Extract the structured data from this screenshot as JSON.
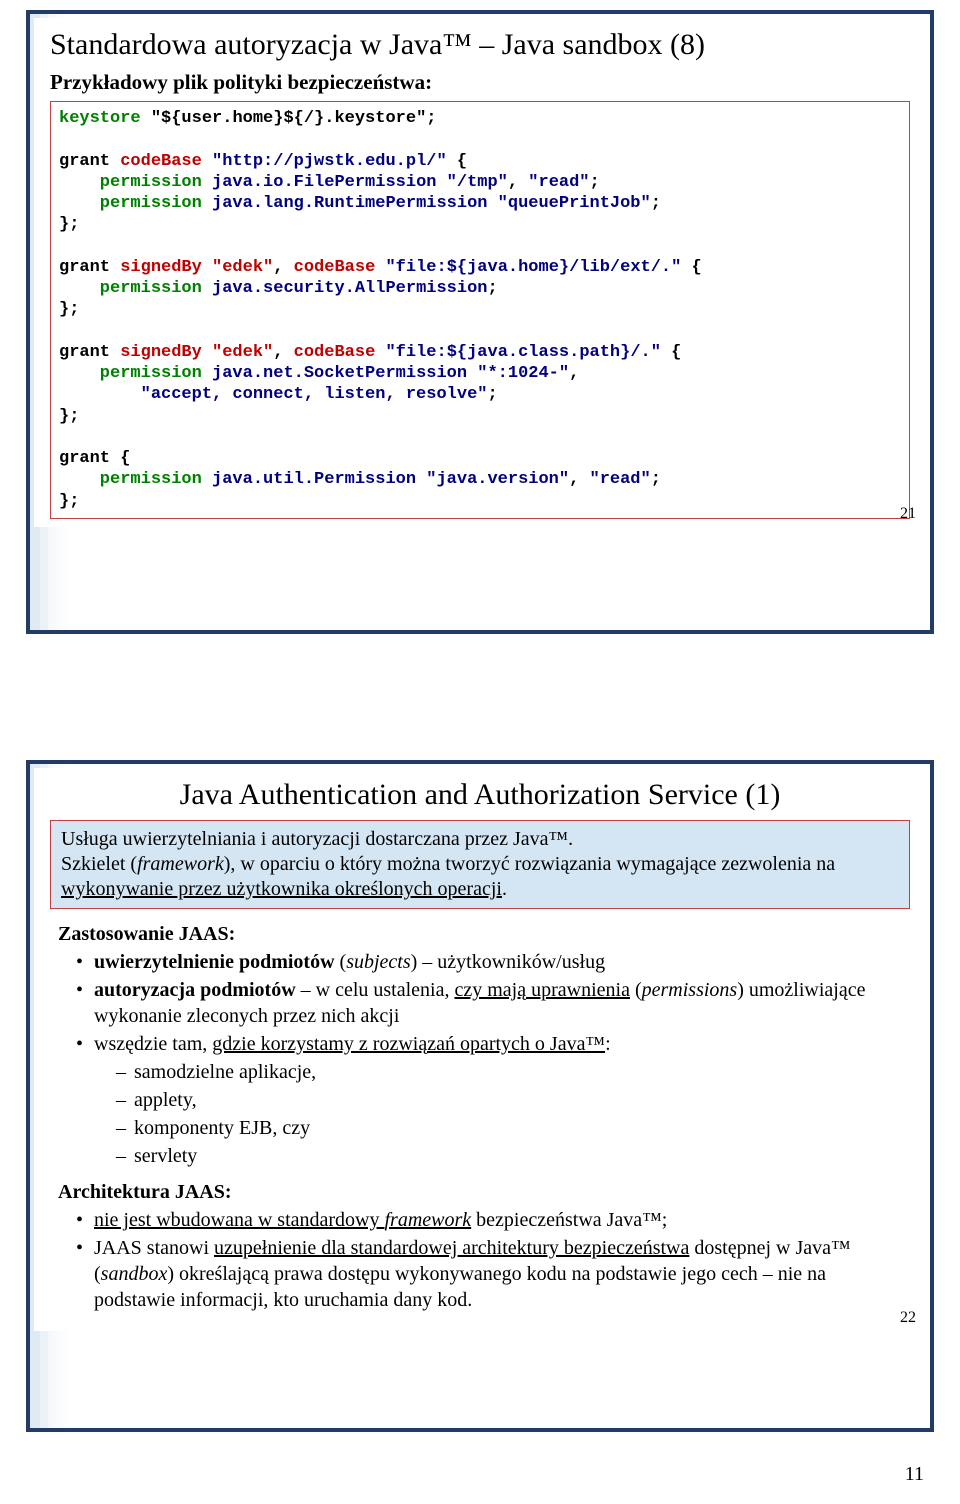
{
  "slide1": {
    "title": "Standardowa autoryzacja w Java™ – Java sandbox (8)",
    "subtitle": "Przykładowy plik polityki bezpieczeństwa:",
    "code": {
      "l1a": "keystore",
      "l1b": " \"${user.home}${/}.keystore\";",
      "l2a": "grant ",
      "l2b": "codeBase",
      "l2c": " \"http://pjwstk.edu.pl/\"",
      "l2d": " {",
      "l3a": "    permission ",
      "l3b": "java.io.FilePermission \"/tmp\"",
      "l3c": ", ",
      "l3d": "\"read\"",
      "l3e": ";",
      "l4a": "    permission ",
      "l4b": "java.lang.RuntimePermission \"queuePrintJob\"",
      "l4c": ";",
      "l5": "};",
      "l6a": "grant ",
      "l6b": "signedBy \"edek\"",
      "l6c": ", ",
      "l6d": "codeBase",
      "l6e": " \"file:${java.home}/lib/ext/.\"",
      "l6f": " {",
      "l7a": "    permission ",
      "l7b": "java.security.AllPermission",
      "l7c": ";",
      "l8": "};",
      "l9a": "grant ",
      "l9b": "signedBy \"edek\"",
      "l9c": ", ",
      "l9d": "codeBase",
      "l9e": " \"file:${java.class.path}/.\"",
      "l9f": " {",
      "l10a": "    permission ",
      "l10b": "java.net.SocketPermission \"*:1024-\"",
      "l10c": ",",
      "l11a": "        \"accept, connect, listen, resolve\"",
      "l11b": ";",
      "l12": "};",
      "l13": "grant {",
      "l14a": "    permission ",
      "l14b": "java.util.Permission \"java.version\"",
      "l14c": ", ",
      "l14d": "\"read\"",
      "l14e": ";",
      "l15": "};"
    },
    "page": "21"
  },
  "slide2": {
    "title": "Java Authentication and Authorization Service (1)",
    "intro": {
      "line1": "Usługa uwierzytelniania i autoryzacji dostarczana przez Java™.",
      "line2a": "Szkielet (",
      "line2b": "framework",
      "line2c": "), w oparciu o który można tworzyć rozwiązania wymagające zezwolenia na ",
      "line2d": "wykonywanie przez użytkownika określonych operacji",
      "line2e": "."
    },
    "section1_title": "Zastosowanie JAAS:",
    "b1a": "uwierzytelnienie podmiotów",
    "b1b": " (",
    "b1c": "subjects",
    "b1d": ") – użytkowników/usług",
    "b2a": "autoryzacja podmiotów",
    "b2b": " – w celu ustalenia, ",
    "b2c": "czy mają uprawnienia",
    "b2d": " (",
    "b2e": "permissions",
    "b2f": ") umożliwiające wykonanie zleconych przez nich akcji",
    "b3a": "wszędzie tam, ",
    "b3b": "gdzie korzystamy z rozwiązań opartych o Java™",
    "b3c": ":",
    "b3_1": "samodzielne aplikacje,",
    "b3_2": "applety,",
    "b3_3": "komponenty EJB, czy",
    "b3_4": "servlety",
    "section2_title": "Architektura JAAS:",
    "a1a": "nie jest wbudowana w standardowy ",
    "a1b": "framework",
    "a1c": " bezpieczeństwa Java™;",
    "a2a": "JAAS stanowi ",
    "a2b": "uzupełnienie dla standardowej architektury bezpieczeństwa",
    "a2c": " dostępnej w Java™ (",
    "a2d": "sandbox",
    "a2e": ") określającą prawa dostępu wykonywanego kodu na podstawie jego cech – nie na podstawie informacji, kto uruchamia dany kod.",
    "page": "22"
  },
  "footer": "11"
}
